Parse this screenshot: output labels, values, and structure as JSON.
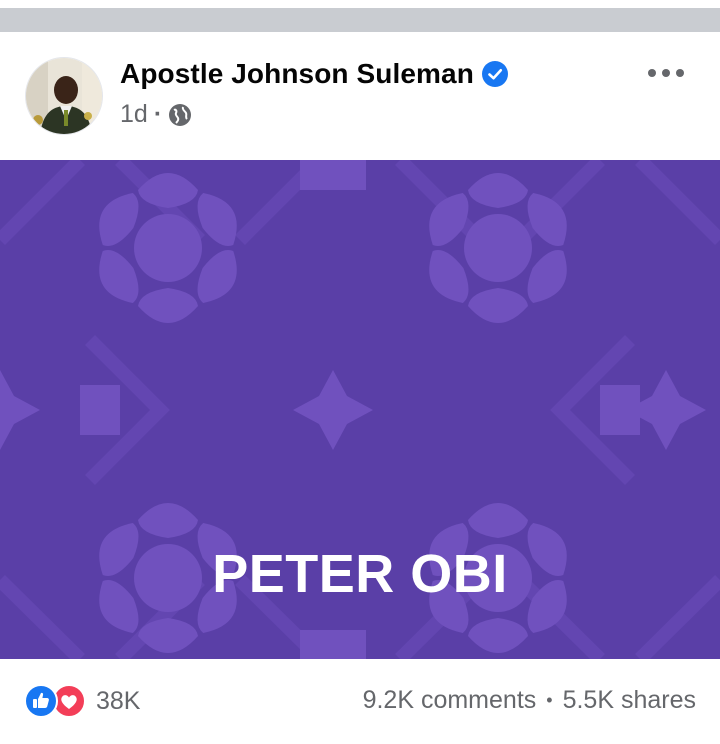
{
  "post": {
    "author": "Apostle Johnson Suleman",
    "verified": true,
    "time": "1d",
    "audience_icon": "globe-icon",
    "text": "PETER OBI",
    "background_color": "#5a3fa7",
    "pattern_color": "#7051be"
  },
  "engagement": {
    "reaction_icons": [
      "like-icon",
      "love-icon"
    ],
    "reactions": "38K",
    "comments": "9.2K comments",
    "shares": "5.5K shares"
  }
}
